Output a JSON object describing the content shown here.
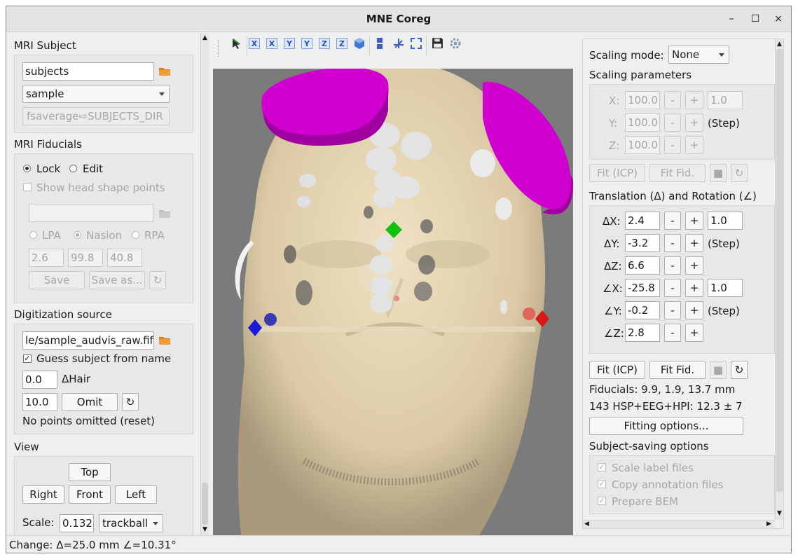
{
  "window": {
    "title": "MNE Coreg",
    "controls": [
      "–",
      "☐",
      "×"
    ]
  },
  "left": {
    "mri_subject": {
      "header": "MRI Subject",
      "subjects_dir": "subjects",
      "subject": "sample",
      "fsaverage_btn": "fsaverage⇨SUBJECTS_DIR"
    },
    "fiducials": {
      "header": "MRI Fiducials",
      "lock": "Lock",
      "edit": "Edit",
      "show_head": "Show head shape points",
      "lpa": "LPA",
      "nasion": "Nasion",
      "rpa": "RPA",
      "coords": [
        "2.6",
        "99.8",
        "40.8"
      ],
      "save": "Save",
      "save_as": "Save as..."
    },
    "digitization": {
      "header": "Digitization source",
      "file": "le/sample_audvis_raw.fif",
      "guess": "Guess subject from name",
      "hair_value": "0.0",
      "hair_label": "ΔHair",
      "omit_value": "10.0",
      "omit_btn": "Omit",
      "omitted_text": "No points omitted (reset)"
    },
    "view": {
      "header": "View",
      "top": "Top",
      "right": "Right",
      "front": "Front",
      "left": "Left",
      "scale_label": "Scale:",
      "scale_value": "0.132",
      "interaction": "trackball"
    }
  },
  "toolbar": {
    "icons": [
      "X",
      "X",
      "Y",
      "Y",
      "Z",
      "Z"
    ]
  },
  "right": {
    "scaling_mode_label": "Scaling mode:",
    "scaling_mode": "None",
    "scaling_params_header": "Scaling parameters",
    "scale_rows": [
      {
        "label": "X:",
        "value": "100.0",
        "step": "1.0"
      },
      {
        "label": "Y:",
        "value": "100.0",
        "step": "(Step)"
      },
      {
        "label": "Z:",
        "value": "100.0",
        "step": ""
      }
    ],
    "fit_icp": "Fit (ICP)",
    "fit_fid": "Fit Fid.",
    "trans_header": "Translation (Δ) and Rotation (∠)",
    "trans_rows": [
      {
        "label": "ΔX:",
        "value": "2.4",
        "step": "1.0"
      },
      {
        "label": "ΔY:",
        "value": "-3.2",
        "step": "(Step)"
      },
      {
        "label": "ΔZ:",
        "value": "6.6",
        "step": ""
      },
      {
        "label": "∠X:",
        "value": "-25.8",
        "step": "1.0"
      },
      {
        "label": "∠Y:",
        "value": "-0.2",
        "step": "(Step)"
      },
      {
        "label": "∠Z:",
        "value": "2.8",
        "step": ""
      }
    ],
    "fiducials_text": "Fiducials: 9.9, 1.9, 13.7 mm",
    "hsp_text": "143 HSP+EEG+HPI: 12.3 ± 7",
    "fitting_options": "Fitting options...",
    "saving_header": "Subject-saving options",
    "save_opts": [
      "Scale label files",
      "Copy annotation files",
      "Prepare BEM"
    ]
  },
  "status": {
    "text": "Change:  Δ=25.0 mm  ∠=10.31°"
  }
}
